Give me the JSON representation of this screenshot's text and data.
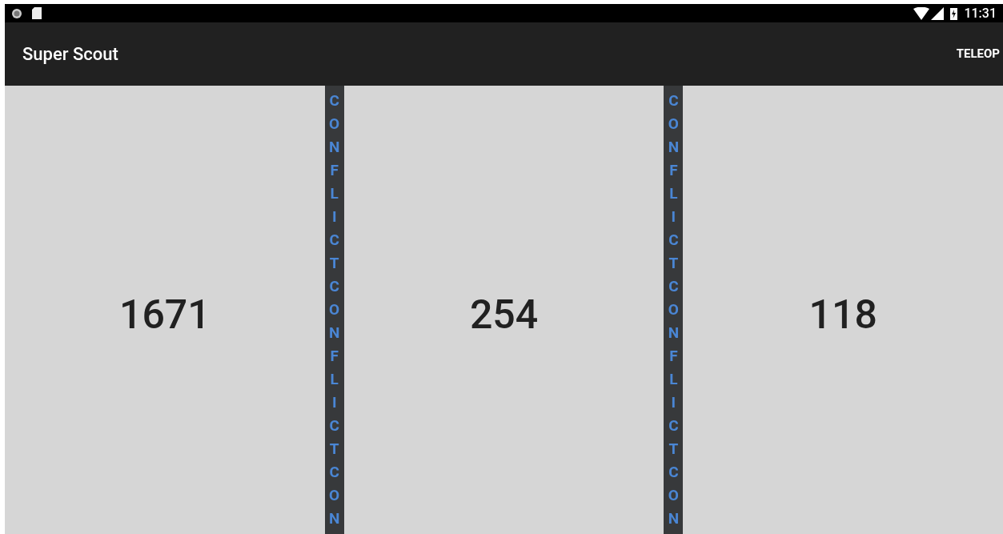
{
  "status_bar": {
    "time": "11:31"
  },
  "toolbar": {
    "title": "Super Scout",
    "action": "TELEOP"
  },
  "panels": [
    {
      "team": "1671"
    },
    {
      "team": "254"
    },
    {
      "team": "118"
    }
  ],
  "dividers": [
    {
      "label": "CONFLICTCONFLICTCON"
    },
    {
      "label": "CONFLICTCONFLICTCON"
    }
  ]
}
